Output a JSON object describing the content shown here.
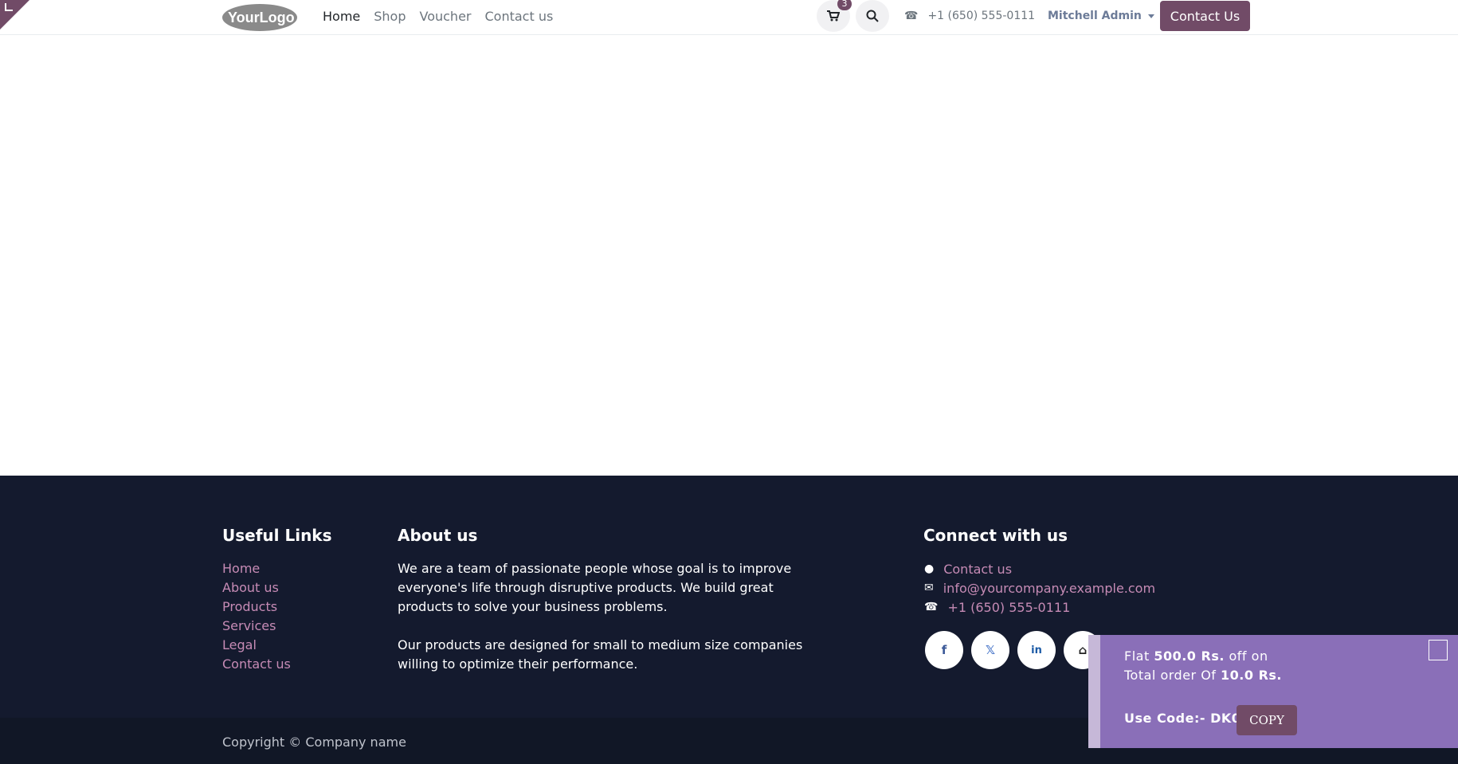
{
  "header": {
    "logo_text": "YourLogo",
    "nav": [
      "Home",
      "Shop",
      "Voucher",
      "Contact us"
    ],
    "cart_count": "3",
    "phone": "+1 (650) 555-0111",
    "user_name": "Mitchell Admin",
    "contact_button": "Contact Us"
  },
  "footer": {
    "useful_links_title": "Useful Links",
    "useful_links": [
      "Home",
      "About us",
      "Products",
      "Services",
      "Legal",
      "Contact us"
    ],
    "about_title": "About us",
    "about_paragraph_1": "We are a team of passionate people whose goal is to improve everyone's life through disruptive products. We build great products to solve your business problems.",
    "about_paragraph_2": "Our products are designed for small to medium size companies willing to optimize their performance.",
    "connect_title": "Connect with us",
    "connect_contact": "Contact us",
    "connect_email": "info@yourcompany.example.com",
    "connect_phone": "+1 (650) 555-0111",
    "copyright": "Copyright © Company name"
  },
  "voucher_popup": {
    "line1_prefix": "Flat ",
    "line1_amount": "500.0 Rs.",
    "line1_suffix": " off on",
    "line2_prefix": "Total order Of ",
    "line2_amount": "10.0 Rs.",
    "code_label": "Use Code:- DK007",
    "copy_button": "COPY"
  },
  "colors": {
    "brand": "#714b67",
    "footer_bg": "#141a2e",
    "link": "#c68bb5",
    "voucher_bg": "#8a6fb8"
  },
  "icons": [
    "cart-icon",
    "search-icon",
    "phone-icon",
    "chat-icon",
    "envelope-icon",
    "facebook-icon",
    "x-icon",
    "linkedin-icon",
    "home-icon",
    "close-icon"
  ]
}
